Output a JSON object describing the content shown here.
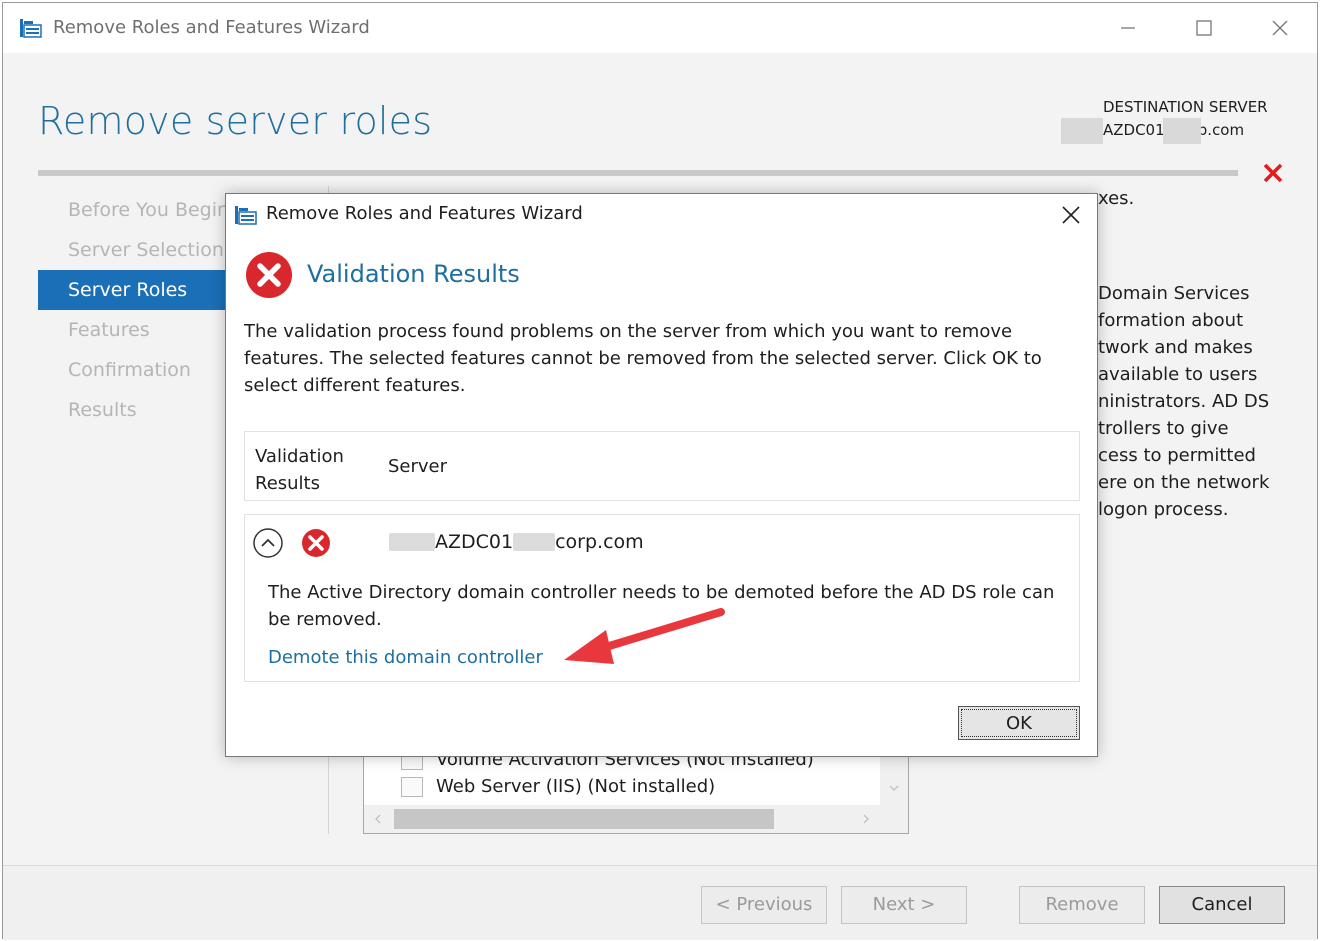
{
  "window": {
    "title": "Remove Roles and Features Wizard",
    "page_title": "Remove server roles",
    "destination_label": "DESTINATION SERVER",
    "destination_server": "AZDC01.      corp.com"
  },
  "nav": {
    "items": [
      {
        "label": "Before You Begin",
        "state": "disabled"
      },
      {
        "label": "Server Selection",
        "state": "disabled"
      },
      {
        "label": "Server Roles",
        "state": "active"
      },
      {
        "label": "Features",
        "state": "disabled"
      },
      {
        "label": "Confirmation",
        "state": "disabled"
      },
      {
        "label": "Results",
        "state": "disabled"
      }
    ]
  },
  "background": {
    "intro_tail": "xes.",
    "description_lines": [
      "Domain Services",
      "formation about",
      "twork and makes",
      "available to users",
      "ninistrators. AD DS",
      "trollers to give",
      "cess to permitted",
      "ere on the network",
      "logon process."
    ],
    "roles": [
      {
        "label": "Volume Activation Services (Not installed)"
      },
      {
        "label": "Web Server (IIS) (Not installed)"
      }
    ]
  },
  "footer": {
    "previous": "< Previous",
    "next": "Next >",
    "remove": "Remove",
    "cancel": "Cancel"
  },
  "dialog": {
    "title": "Remove Roles and Features Wizard",
    "heading": "Validation Results",
    "message": "The validation process found problems on the server from which you want to remove features. The selected features cannot be removed from the selected server.  Click OK to select different features.",
    "columns": {
      "results": "Validation Results",
      "server": "Server"
    },
    "result": {
      "server_prefix": "AZDC01",
      "server_suffix": "corp.com",
      "message": "The Active Directory domain controller needs to be demoted before the AD DS role can be removed.",
      "link": "Demote this domain controller"
    },
    "ok": "OK"
  },
  "colors": {
    "accent": "#1f6f9e",
    "nav_active": "#1b6fb6",
    "error": "#d9272e",
    "annotation_arrow": "#e8383d"
  }
}
